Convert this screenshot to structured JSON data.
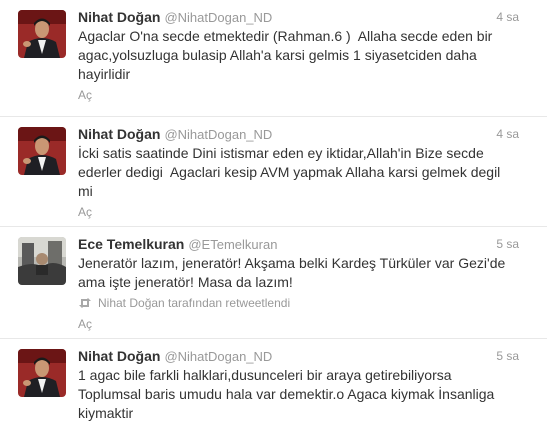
{
  "tweets": [
    {
      "name": "Nihat Doğan",
      "handle": "@NihatDogan_ND",
      "time": "4 sa",
      "text": "Agaclar O'na secde etmektedir (Rahman.6 )  Allaha secde eden bir\nagac,yolsuzluga bulasip Allah'a karsi gelmis 1 siyasetciden daha\nhayirlidir",
      "action": "Aç"
    },
    {
      "name": "Nihat Doğan",
      "handle": "@NihatDogan_ND",
      "time": "4 sa",
      "text": "İcki satis saatinde Dini istismar eden ey iktidar,Allah'in Bize secde\nederler dedigi  Agaclari kesip AVM yapmak Allaha karsi gelmek degil\nmi",
      "action": "Aç"
    },
    {
      "name": "Ece Temelkuran",
      "handle": "@ETemelkuran",
      "time": "5 sa",
      "text": "Jeneratör lazım, jeneratör! Akşama belki Kardeş Türküler var Gezi'de\nama işte jeneratör! Masa da lazım!",
      "retweet": "Nihat Doğan tarafından retweetlendi",
      "action": "Aç"
    },
    {
      "name": "Nihat Doğan",
      "handle": "@NihatDogan_ND",
      "time": "5 sa",
      "text": "1 agac bile farkli halklari,dusunceleri bir araya getirebiliyorsa\nToplumsal baris umudu hala var demektir.o Agaca kiymak İnsanliga\nkiymaktir",
      "action": "Aç"
    }
  ]
}
